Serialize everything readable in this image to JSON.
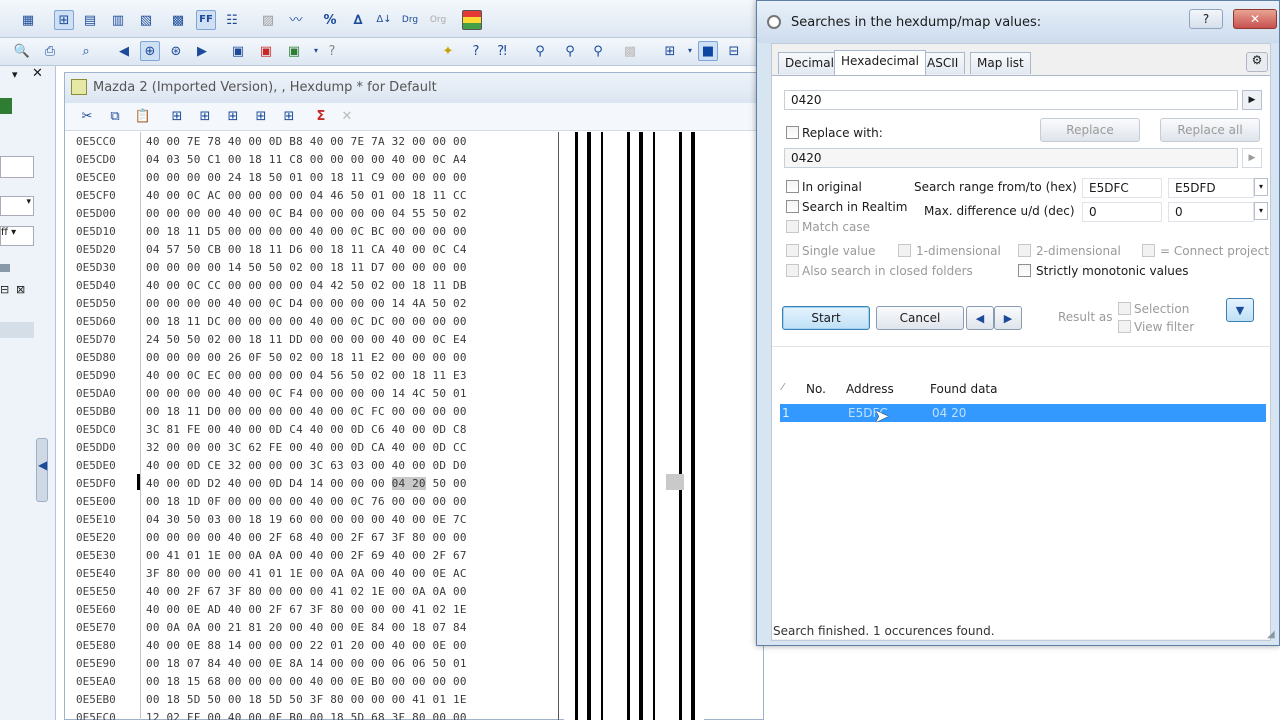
{
  "hexdump": {
    "title": "Mazda 2 (Imported Version), , Hexdump * for Default",
    "rows": [
      {
        "addr": "0E5CC0",
        "bytes": "40 00 7E 78 40 00 0D B8 40 00 7E 7A 32 00 00 00"
      },
      {
        "addr": "0E5CD0",
        "bytes": "04 03 50 C1 00 18 11 C8 00 00 00 00 40 00 0C A4"
      },
      {
        "addr": "0E5CE0",
        "bytes": "00 00 00 00 24 18 50 01 00 18 11 C9 00 00 00 00"
      },
      {
        "addr": "0E5CF0",
        "bytes": "40 00 0C AC 00 00 00 00 04 46 50 01 00 18 11 CC"
      },
      {
        "addr": "0E5D00",
        "bytes": "00 00 00 00 40 00 0C B4 00 00 00 00 04 55 50 02"
      },
      {
        "addr": "0E5D10",
        "bytes": "00 18 11 D5 00 00 00 00 40 00 0C BC 00 00 00 00"
      },
      {
        "addr": "0E5D20",
        "bytes": "04 57 50 CB 00 18 11 D6 00 18 11 CA 40 00 0C C4"
      },
      {
        "addr": "0E5D30",
        "bytes": "00 00 00 00 14 50 50 02 00 18 11 D7 00 00 00 00"
      },
      {
        "addr": "0E5D40",
        "bytes": "40 00 0C CC 00 00 00 00 04 42 50 02 00 18 11 DB"
      },
      {
        "addr": "0E5D50",
        "bytes": "00 00 00 00 40 00 0C D4 00 00 00 00 14 4A 50 02"
      },
      {
        "addr": "0E5D60",
        "bytes": "00 18 11 DC 00 00 00 00 40 00 0C DC 00 00 00 00"
      },
      {
        "addr": "0E5D70",
        "bytes": "24 50 50 02 00 18 11 DD 00 00 00 00 40 00 0C E4"
      },
      {
        "addr": "0E5D80",
        "bytes": "00 00 00 00 26 0F 50 02 00 18 11 E2 00 00 00 00"
      },
      {
        "addr": "0E5D90",
        "bytes": "40 00 0C EC 00 00 00 00 04 56 50 02 00 18 11 E3"
      },
      {
        "addr": "0E5DA0",
        "bytes": "00 00 00 00 40 00 0C F4 00 00 00 00 14 4C 50 01"
      },
      {
        "addr": "0E5DB0",
        "bytes": "00 18 11 D0 00 00 00 00 40 00 0C FC 00 00 00 00"
      },
      {
        "addr": "0E5DC0",
        "bytes": "3C 81 FE 00 40 00 0D C4 40 00 0D C6 40 00 0D C8"
      },
      {
        "addr": "0E5DD0",
        "bytes": "32 00 00 00 3C 62 FE 00 40 00 0D CA 40 00 0D CC"
      },
      {
        "addr": "0E5DE0",
        "bytes": "40 00 0D CE 32 00 00 00 3C 63 03 00 40 00 0D D0"
      },
      {
        "addr": "0E5DF0",
        "bytes": "40 00 0D D2 40 00 0D D4 14 00 00 00 04 20 50 00"
      },
      {
        "addr": "0E5E00",
        "bytes": "00 18 1D 0F 00 00 00 00 40 00 0C 76 00 00 00 00"
      },
      {
        "addr": "0E5E10",
        "bytes": "04 30 50 03 00 18 19 60 00 00 00 00 40 00 0E 7C"
      },
      {
        "addr": "0E5E20",
        "bytes": "00 00 00 00 40 00 2F 68 40 00 2F 67 3F 80 00 00"
      },
      {
        "addr": "0E5E30",
        "bytes": "00 41 01 1E 00 0A 0A 00 40 00 2F 69 40 00 2F 67"
      },
      {
        "addr": "0E5E40",
        "bytes": "3F 80 00 00 00 41 01 1E 00 0A 0A 00 40 00 0E AC"
      },
      {
        "addr": "0E5E50",
        "bytes": "40 00 2F 67 3F 80 00 00 00 41 02 1E 00 0A 0A 00"
      },
      {
        "addr": "0E5E60",
        "bytes": "40 00 0E AD 40 00 2F 67 3F 80 00 00 00 41 02 1E"
      },
      {
        "addr": "0E5E70",
        "bytes": "00 0A 0A 00 21 81 20 00 40 00 0E 84 00 18 07 84"
      },
      {
        "addr": "0E5E80",
        "bytes": "40 00 0E 88 14 00 00 00 22 01 20 00 40 00 0E 00"
      },
      {
        "addr": "0E5E90",
        "bytes": "00 18 07 84 40 00 0E 8A 14 00 00 00 06 06 50 01"
      },
      {
        "addr": "0E5EA0",
        "bytes": "00 18 15 68 00 00 00 00 40 00 0E B0 00 00 00 00"
      },
      {
        "addr": "0E5EB0",
        "bytes": "00 18 5D 50 00 18 5D 50 3F 80 00 00 00 41 01 1E"
      },
      {
        "addr": "0E5EC0",
        "bytes": "12 02 FF 00 40 00 0F B0 00 18 5D 68 3F 80 00 00"
      }
    ]
  },
  "dialog": {
    "title": "Searches in the hexdump/map values:",
    "help_btn": "?",
    "close_btn": "✕",
    "tabs": [
      "Decimal",
      "Hexadecimal",
      "ASCII",
      "Map list"
    ],
    "active_tab": "Hexadecimal",
    "search_value": "0420",
    "replace_label": "Replace with:",
    "replace_value": "0420",
    "replace_btn": "Replace",
    "replace_all_btn": "Replace all",
    "in_original": "In original",
    "search_in_realtime": "Search in Realtim",
    "match_case": "Match case",
    "single_value": "Single value",
    "one_dimensional": "1-dimensional",
    "two_dimensional": "2-dimensional",
    "connect_project": "= Connect project",
    "also_search": "Also search in closed folders",
    "strictly_monotonic": "Strictly monotonic values",
    "range_label": "Search range from/to (hex)",
    "range_from": "E5DFC",
    "range_to": "E5DFD",
    "maxdiff_label": "Max. difference u/d (dec)",
    "maxdiff_u": "0",
    "maxdiff_d": "0",
    "start_btn": "Start",
    "cancel_btn": "Cancel",
    "result_as": "Result as",
    "selection": "Selection",
    "view_filter": "View filter",
    "results": {
      "headers": [
        "No.",
        "Address",
        "Found data"
      ],
      "rows": [
        {
          "no": "1",
          "address": "E5DFC",
          "data": "04 20"
        }
      ]
    },
    "status": "Search finished. 1 occurences found."
  },
  "colors": {
    "accent": "#3399ff",
    "title_bar": "#d7e4f2"
  }
}
